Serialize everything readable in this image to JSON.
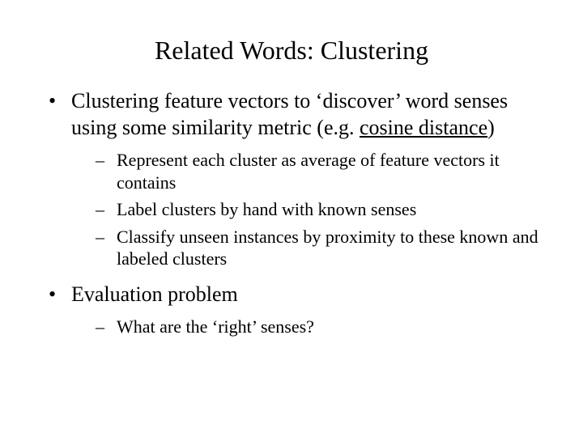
{
  "title": "Related Words: Clustering",
  "bullets": {
    "item1_part1": "Clustering feature vectors to ‘discover’ word senses using some similarity metric (e.g. ",
    "item1_underlined": "cosine distance",
    "item1_part2": ")",
    "sub1": "Represent each cluster as average of feature vectors it contains",
    "sub2": "Label clusters by hand with known senses",
    "sub3": "Classify unseen instances by proximity to these known and labeled clusters",
    "item2": "Evaluation problem",
    "sub4": "What are the ‘right’ senses?"
  }
}
